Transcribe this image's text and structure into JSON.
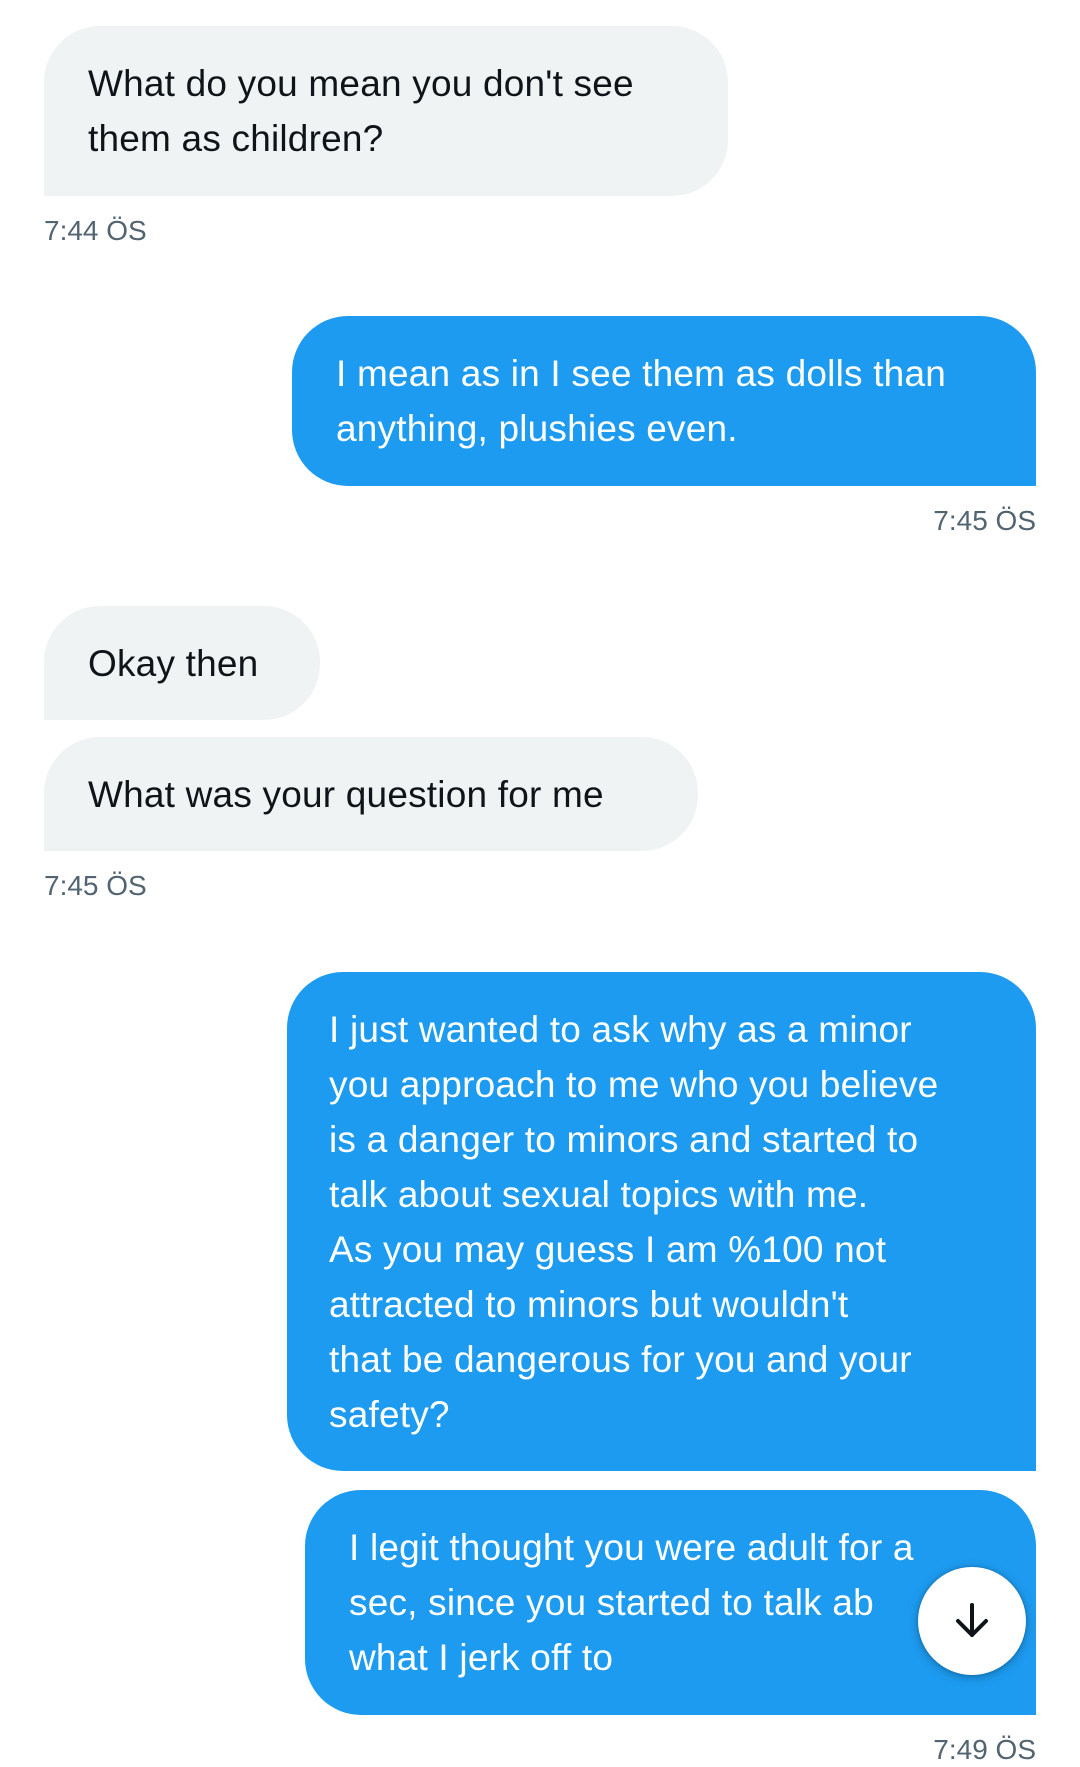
{
  "conversation": {
    "messages": [
      {
        "direction": "incoming",
        "text": "What do you mean you don't see\nthem as children?"
      },
      {
        "direction": "outgoing",
        "text": "I mean as in I see them as dolls than\nanything, plushies even."
      },
      {
        "direction": "incoming",
        "text": "Okay then"
      },
      {
        "direction": "incoming",
        "text": "What was your question for me"
      },
      {
        "direction": "outgoing",
        "text": "I just wanted to ask why as a minor\nyou approach to me who you believe\nis a danger to minors and started to\ntalk about sexual topics with me.\nAs you may guess I am %100 not\nattracted to minors but wouldn't\nthat be dangerous for you and your\nsafety?"
      },
      {
        "direction": "outgoing",
        "text": "I legit thought you were adult for a\nsec, since you started to talk ab\nwhat I jerk off to"
      }
    ],
    "timestamps": [
      "7:44 ÖS",
      "7:45 ÖS",
      "7:45 ÖS",
      "7:49 ÖS"
    ]
  },
  "scroll_button": {
    "icon": "arrow-down-icon"
  },
  "colors": {
    "outgoing_bubble": "#1d9bf0",
    "incoming_bubble": "#eff3f4",
    "timestamp": "#536471"
  }
}
